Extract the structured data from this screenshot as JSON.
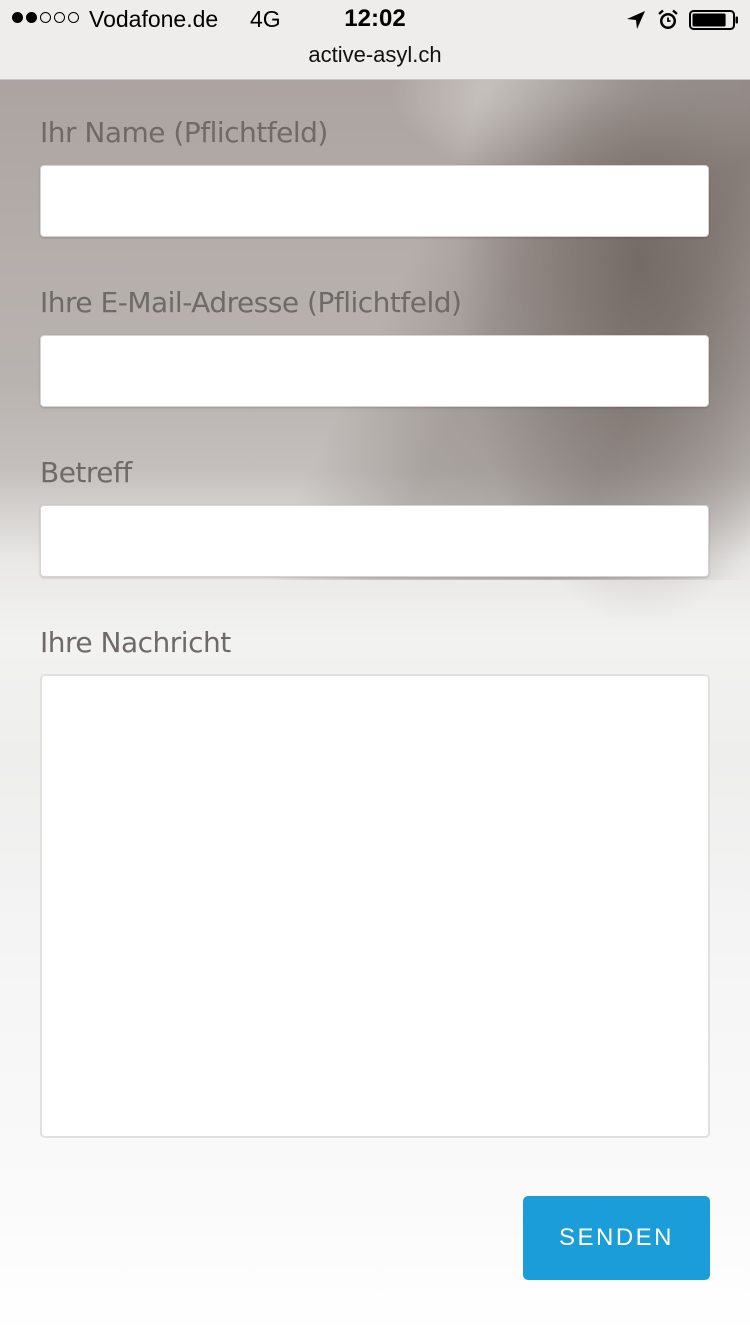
{
  "status_bar": {
    "signal_bars": [
      true,
      true,
      false,
      false,
      false
    ],
    "carrier": "Vodafone.de",
    "network": "4G",
    "time": "12:02",
    "icons": [
      "location-arrow-icon",
      "alarm-clock-icon",
      "battery-icon"
    ],
    "battery_level": 0.85
  },
  "browser": {
    "url": "active-asyl.ch"
  },
  "form": {
    "name_label": "Ihr Name (Pflichtfeld)",
    "name_value": "",
    "email_label": "Ihre E-Mail-Adresse (Pflichtfeld)",
    "email_value": "",
    "subject_label": "Betreff",
    "subject_value": "",
    "message_label": "Ihre Nachricht",
    "message_value": "",
    "submit_label": "SENDEN"
  },
  "colors": {
    "accent": "#1a9dd8",
    "label_text": "#6f6a68"
  }
}
